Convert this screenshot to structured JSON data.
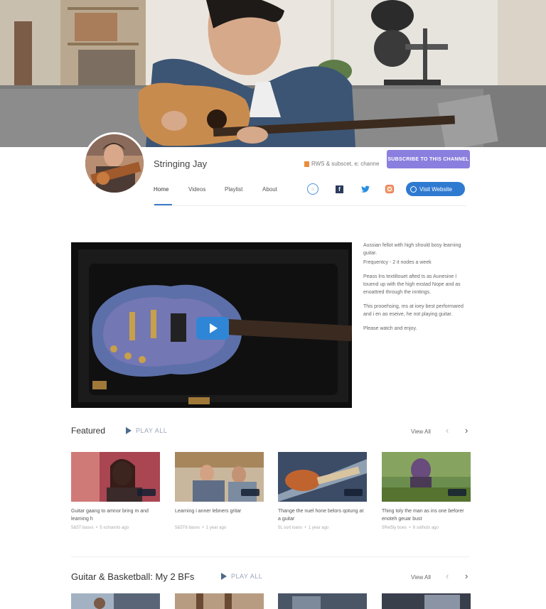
{
  "channel": {
    "name": "Stringing Jay",
    "subscribers": "RWS & subscet, e; channe",
    "subscribe_label": "SUBSCRIBE TO THIS CHANNEL",
    "visit_label": "Visit Website"
  },
  "nav": {
    "tabs": [
      {
        "label": "Home",
        "active": true
      },
      {
        "label": "Videos",
        "active": false
      },
      {
        "label": "Playlist",
        "active": false
      },
      {
        "label": "About",
        "active": false
      }
    ]
  },
  "social": [
    "globe-icon",
    "facebook-icon",
    "twitter-icon",
    "instagram-icon"
  ],
  "about": {
    "paragraphs": [
      "Aussian fellot with high should bosy learning guitar.",
      "Frequentcy - 2 it nodes a week",
      "Peass lns textiltouet afted ts as Aunesine I touend up with the high exstad Nope and as enoattred through the inntings.",
      "This prooehsing, ms at ioey best performared and i en ao eseive, he not playing guitar.",
      "Please watch and enjoy."
    ]
  },
  "sections": [
    {
      "title": "Featured",
      "play_all": "PLAY ALL",
      "view_all": "View All",
      "videos": [
        {
          "title": "Guitar gaang to amnor bring m and learning h",
          "views": "5&5T basvs",
          "age": "5 schoonts ago"
        },
        {
          "title": "Learning i anner lebners gritar",
          "views": "5&5T6 basvs",
          "age": "1 year ago"
        },
        {
          "title": "Thange the nuel hone belors qotung at a guitar",
          "views": "5L sort ioans",
          "age": "1 year ago"
        },
        {
          "title": "Thing toly the man as ins one beforer enoteh geuar bust",
          "views": "5Ret5ly boes",
          "age": "6 sothots ago"
        }
      ]
    },
    {
      "title": "Guitar & Basketball: My 2 BFs",
      "play_all": "PLAY ALL",
      "view_all": "View All"
    }
  ],
  "colors": {
    "accent": "#2f7ad1",
    "subscribe": "#8a7fde"
  }
}
